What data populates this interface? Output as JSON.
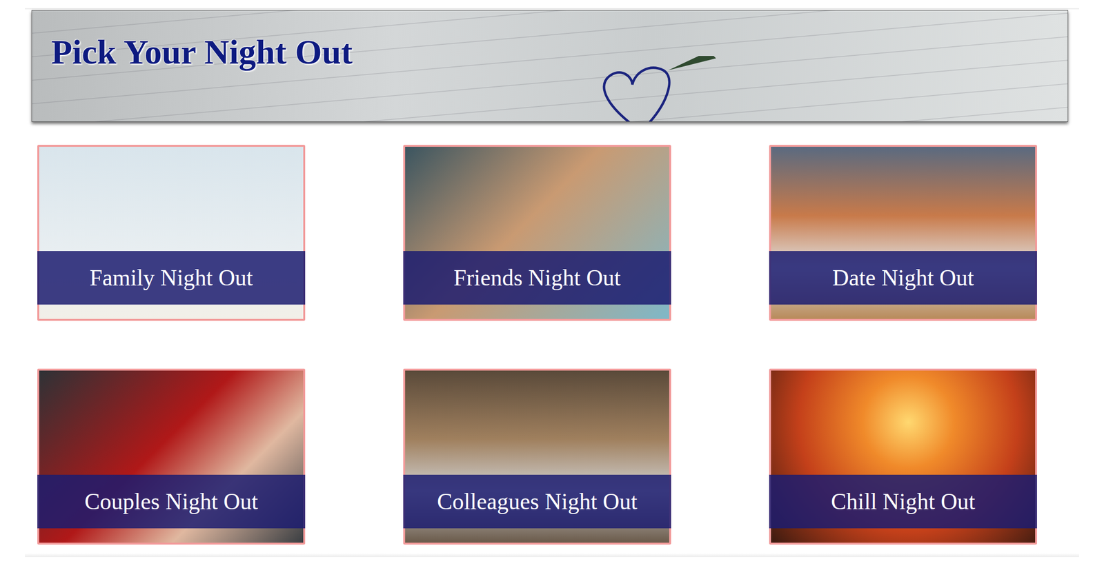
{
  "header": {
    "title": "Pick Your Night Out"
  },
  "cards": [
    {
      "label": "Family Night Out"
    },
    {
      "label": "Friends Night Out"
    },
    {
      "label": "Date Night Out"
    },
    {
      "label": "Couples Night Out"
    },
    {
      "label": "Colleagues Night Out"
    },
    {
      "label": "Chill Night Out"
    }
  ]
}
